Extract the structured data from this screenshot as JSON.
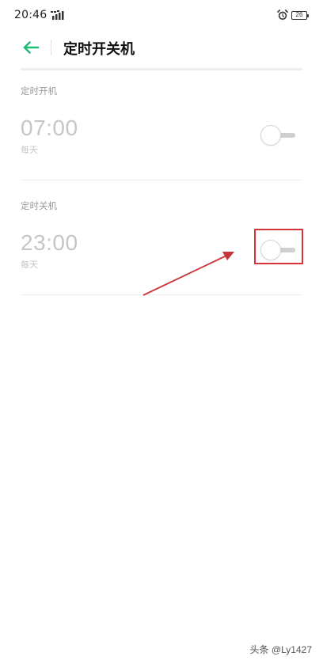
{
  "status_bar": {
    "time": "20:46",
    "battery_level": "26",
    "signal_icon": "signal-icon",
    "alarm_icon": "alarm-clock-icon"
  },
  "header": {
    "title": "定时开关机",
    "back_icon": "arrow-left-icon",
    "accent_color": "#1fbf7a"
  },
  "schedule_on": {
    "label": "定时开机",
    "time": "07:00",
    "repeat": "每天",
    "enabled": false
  },
  "schedule_off": {
    "label": "定时关机",
    "time": "23:00",
    "repeat": "每天",
    "enabled": false
  },
  "annotation": {
    "color": "#d9343b"
  },
  "watermark": {
    "text": "头条 @Ly1427"
  }
}
